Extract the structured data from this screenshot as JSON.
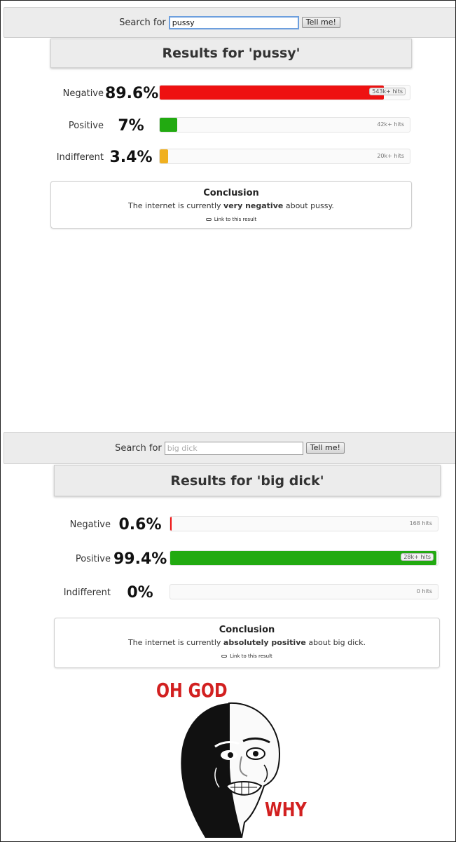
{
  "screens": [
    {
      "search_label": "Search for",
      "query_value": "pussy",
      "query_placeholder": "",
      "button_label": "Tell me!",
      "results_title": "Results for 'pussy'",
      "rows": [
        {
          "label": "Negative",
          "percent_text": "89.6%",
          "fraction": 0.896,
          "hits": "543k+ hits",
          "color": "#ee1111"
        },
        {
          "label": "Positive",
          "percent_text": "7%",
          "fraction": 0.07,
          "hits": "42k+ hits",
          "color": "#22aa11"
        },
        {
          "label": "Indifferent",
          "percent_text": "3.4%",
          "fraction": 0.034,
          "hits": "20k+ hits",
          "color": "#f0b020"
        }
      ],
      "conclusion": {
        "title": "Conclusion",
        "prefix": "The internet is currently",
        "verdict": "very negative",
        "suffix": "about pussy.",
        "link": "Link to this result"
      }
    },
    {
      "search_label": "Search for",
      "query_value": "",
      "query_placeholder": "big dick",
      "button_label": "Tell me!",
      "results_title": "Results for 'big dick'",
      "rows": [
        {
          "label": "Negative",
          "percent_text": "0.6%",
          "fraction": 0.006,
          "hits": "168 hits",
          "color": "#ee1111"
        },
        {
          "label": "Positive",
          "percent_text": "99.4%",
          "fraction": 0.994,
          "hits": "28k+ hits",
          "color": "#22aa11"
        },
        {
          "label": "Indifferent",
          "percent_text": "0%",
          "fraction": 0,
          "hits": "0 hits",
          "color": "#f0b020"
        }
      ],
      "conclusion": {
        "title": "Conclusion",
        "prefix": "The internet is currently",
        "verdict": "absolutely positive",
        "suffix": "about big dick.",
        "link": "Link to this result"
      }
    }
  ],
  "meme": {
    "top_text": "OH GOD",
    "bottom_text": "WHY",
    "text_color": "#d22020"
  }
}
